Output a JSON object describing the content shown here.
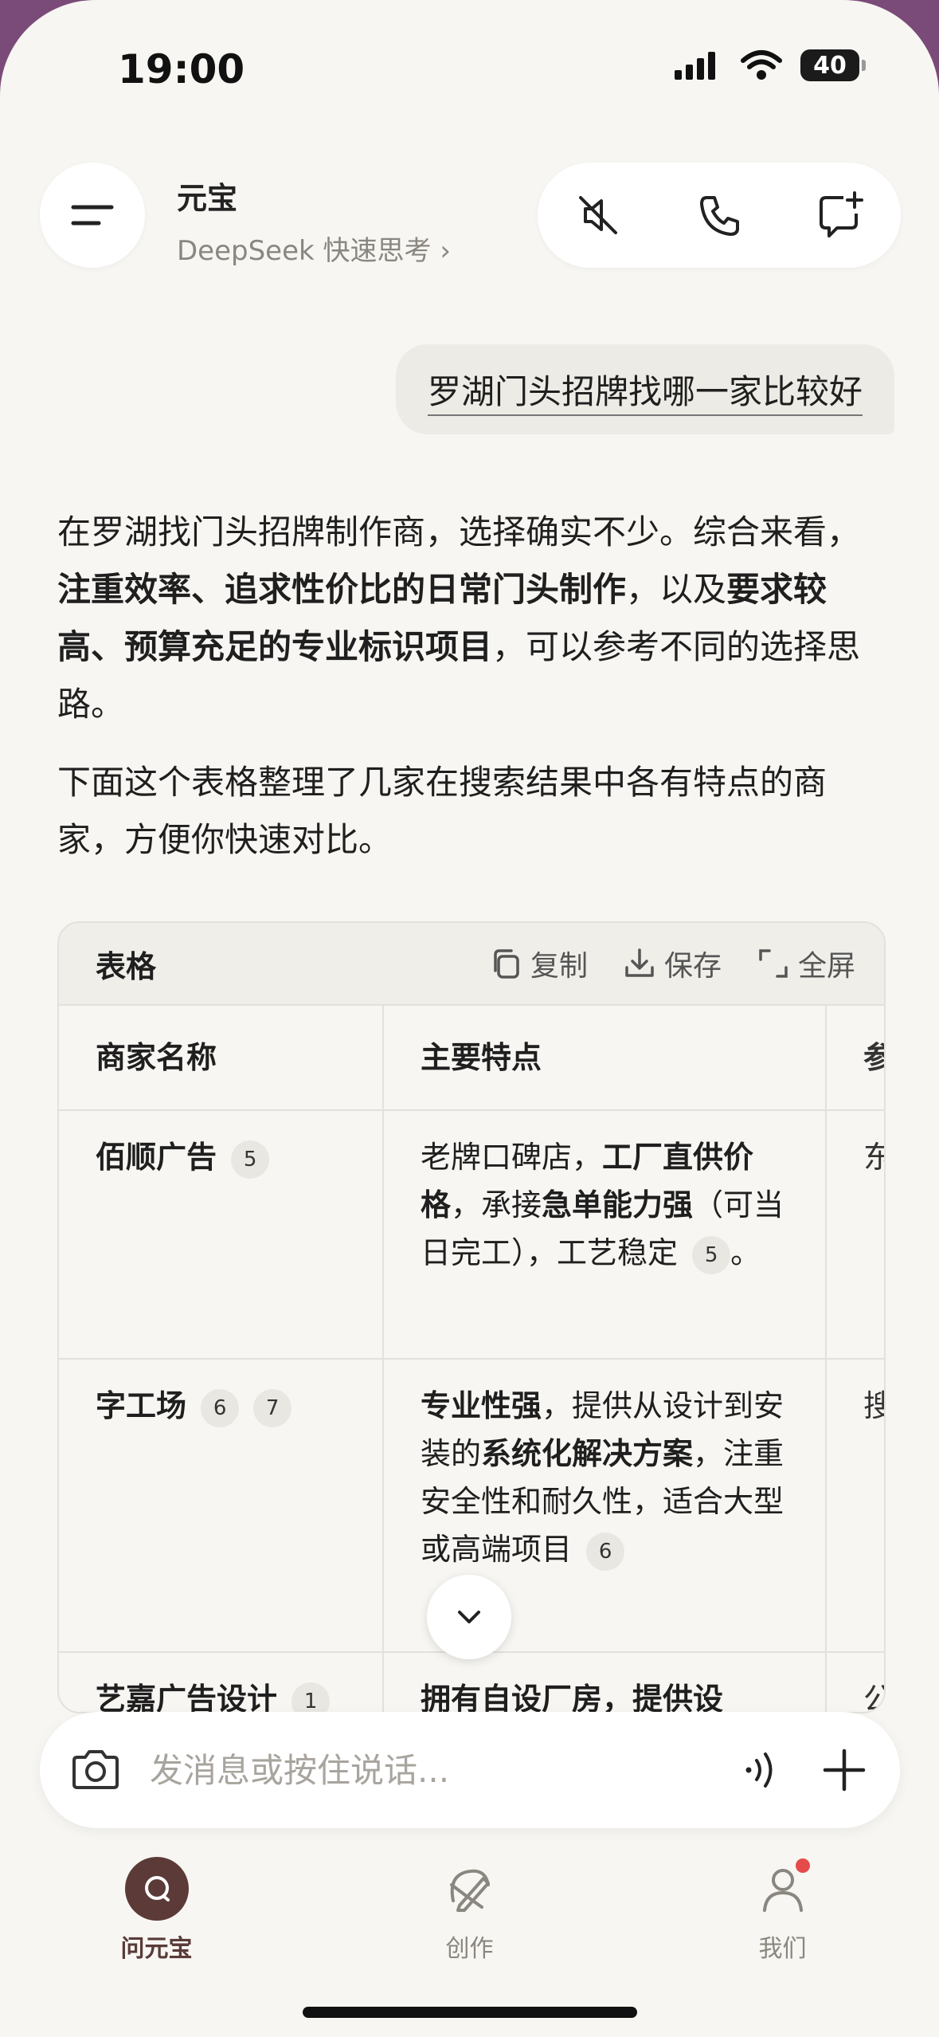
{
  "status": {
    "time": "19:00",
    "battery": "40"
  },
  "header": {
    "title": "元宝",
    "subtitle": "DeepSeek 快速思考 ›"
  },
  "user_message": "罗湖门头招牌找哪一家比较好",
  "answer": {
    "p1_a": "在罗湖找门头招牌制作商，选择确实不少。综合来看，",
    "p1_b": "注重效率、追求性价比的日常门头制作",
    "p1_c": "，以及",
    "p1_d": "要求较高、预算充足的专业标识项目",
    "p1_e": "，可以参考不同的选择思路。",
    "p2": "下面这个表格整理了几家在搜索结果中各有特点的商家，方便你快速对比。"
  },
  "table": {
    "label": "表格",
    "copy": "复制",
    "save": "保存",
    "fullscreen": "全屏",
    "headers": [
      "商家名称",
      "主要特点",
      "参"
    ],
    "rows": [
      {
        "name": "佰顺广告",
        "cites": [
          "5"
        ],
        "f1": "老牌口碑店，",
        "f2": "工厂直供价格",
        "f3": "，承接",
        "f4": "急单能力强",
        "f5": "（可当日完工），工艺稳定",
        "fcite": "5",
        "f6": "。",
        "third": "东"
      },
      {
        "name": "字工场",
        "cites": [
          "6",
          "7"
        ],
        "f1": "专业性强",
        "f2": "，提供从设计到安装的",
        "f3": "系统化解决方案",
        "f4": "，注重安全性和耐久性，适合大型或高端项目",
        "fcite": "6",
        "third": "搜坦"
      },
      {
        "name": "艺嘉广告设计",
        "cites": [
          "1"
        ],
        "f1": "拥有自设厂房，提供设",
        "third": "公"
      }
    ]
  },
  "composer": {
    "placeholder": "发消息或按住说话..."
  },
  "tabs": [
    {
      "label": "问元宝"
    },
    {
      "label": "创作"
    },
    {
      "label": "我们"
    }
  ]
}
